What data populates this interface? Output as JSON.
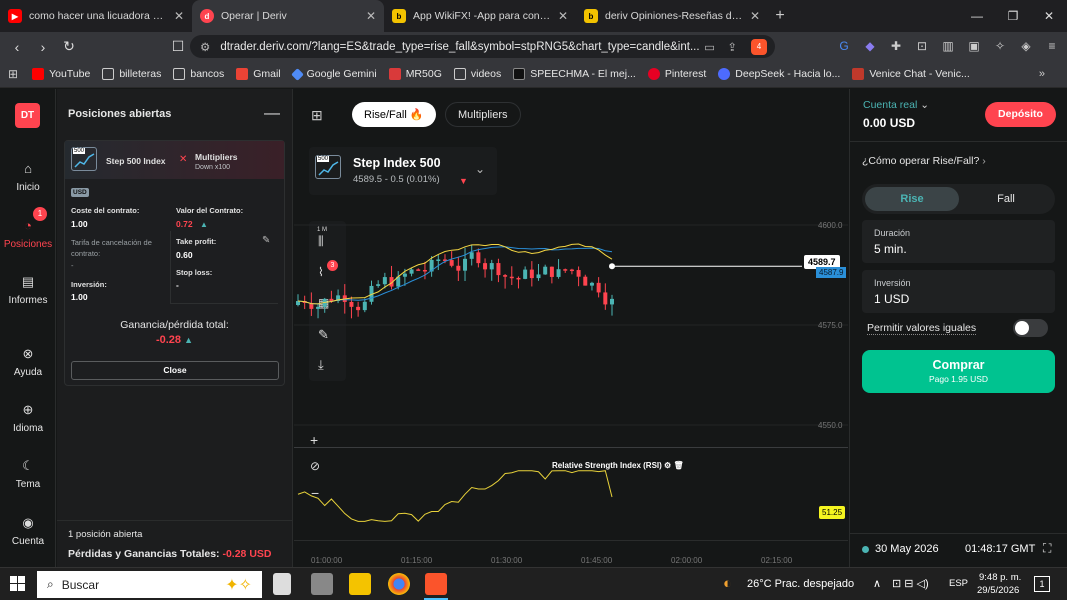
{
  "browser": {
    "tabs": [
      {
        "title": "como hacer una licuadora casera - Yo",
        "active": false
      },
      {
        "title": "Operar | Deriv",
        "active": true
      },
      {
        "title": "App WikiFX! -App para consultar la r",
        "active": false
      },
      {
        "title": "deriv Opiniones-Reseñas de Forex Br",
        "active": false
      }
    ],
    "url": "dtrader.deriv.com/?lang=ES&trade_type=rise_fall&symbol=stpRNG5&chart_type=candle&int...",
    "bookmarks": [
      "YouTube",
      "billeteras",
      "bancos",
      "Gmail",
      "Google Gemini",
      "MR50G",
      "videos",
      "SPEECHMA - El mej...",
      "Pinterest",
      "DeepSeek - Hacia lo...",
      "Venice Chat - Venic..."
    ],
    "extension_badge": "4"
  },
  "app": {
    "logo": "DT",
    "nav": [
      {
        "label": "Inicio",
        "icon": "home-icon"
      },
      {
        "label": "Posiciones",
        "icon": "positions-icon",
        "badge": "1"
      },
      {
        "label": "Informes",
        "icon": "reports-icon"
      },
      {
        "label": "Ayuda",
        "icon": "help-icon"
      },
      {
        "label": "Idioma",
        "icon": "globe-icon"
      },
      {
        "label": "Tema",
        "icon": "moon-icon"
      },
      {
        "label": "Cuenta",
        "icon": "account-icon"
      }
    ]
  },
  "positions": {
    "title": "Posiciones abiertas",
    "card": {
      "icon_tag": "500",
      "symbol": "Step 500 Index",
      "type": "Multipliers",
      "direction": "Down x100",
      "currency": "USD",
      "cost_label": "Coste del contrato:",
      "cost_value": "1.00",
      "value_label": "Valor del Contrato:",
      "value_value": "0.72",
      "cancel_label": "Tarifa de cancelación de contrato:",
      "cancel_value": "-",
      "tp_label": "Take profit:",
      "tp_value": "0.60",
      "sl_label": "Stop loss:",
      "sl_value": "-",
      "investment_label": "Inversión:",
      "investment_value": "1.00",
      "pnl_label": "Ganancia/pérdida total:",
      "pnl_value": "-0.28",
      "close_label": "Close"
    },
    "open_count": "1 posición abierta",
    "total_label": "Pérdidas y Ganancias Totales:",
    "total_value": "-0.28 USD"
  },
  "chart": {
    "trade_types": [
      "Rise/Fall 🔥",
      "Multipliers"
    ],
    "symbol": "Step Index 500",
    "symbol_tag": "500",
    "quote": "4589.5 - 0.5 (0.01%)",
    "current_price": "4589.7",
    "hidden_label": "4587.9",
    "price_ticks": [
      "4600.0",
      "4575.0",
      "4550.0"
    ],
    "time_ticks": [
      "01:00:00",
      "01:15:00",
      "01:30:00",
      "01:45:00",
      "02:00:00",
      "02:15:00"
    ],
    "indicator_badge": "3",
    "timeframe": "1 M",
    "rsi_label": "Relative Strength Index (RSI)",
    "rsi_value": "51.25",
    "date": "30 May 2026",
    "time": "01:48:17 GMT",
    "colors": {
      "up": "#4bb4b3",
      "down": "#ff444f",
      "ma_yellow": "#f5d743",
      "ma_blue": "#2a8fd8"
    }
  },
  "chart_data": {
    "type": "candlestick",
    "x_range": [
      "01:00:00",
      "02:15:00"
    ],
    "ylim": [
      4545,
      4605
    ],
    "last_price": 4589.7,
    "rsi_last": 51.25
  },
  "order": {
    "account_label": "Cuenta real",
    "balance": "0.00 USD",
    "deposit": "Depósito",
    "howto": "¿Cómo operar Rise/Fall?",
    "rise": "Rise",
    "fall": "Fall",
    "duration_label": "Duración",
    "duration_value": "5 min.",
    "investment_label": "Inversión",
    "investment_value": "1 USD",
    "equal_label": "Permitir valores iguales",
    "buy_label": "Comprar",
    "payout": "Pago  1.95 USD"
  },
  "taskbar": {
    "search": "Buscar",
    "weather": "26°C  Prac. despejado",
    "lang": "ESP",
    "time": "9:48 p. m.",
    "date": "29/5/2026",
    "notif": "1"
  }
}
